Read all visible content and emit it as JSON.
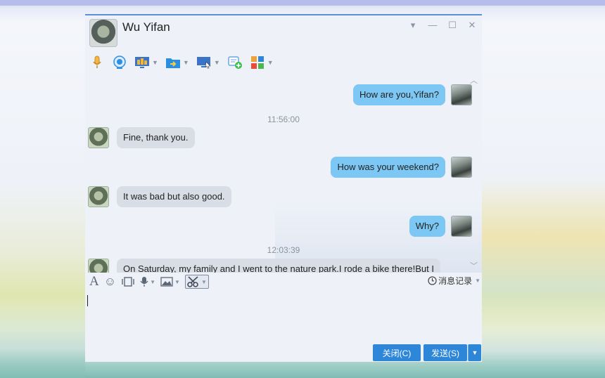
{
  "window": {
    "contact_name": "Wu Yifan",
    "controls": {
      "menu": "▾",
      "minimize": "—",
      "maximize": "☐",
      "close": "✕"
    }
  },
  "toolbar": {
    "items": [
      {
        "name": "voice-call",
        "icon": "microphone-icon",
        "dropdown": false
      },
      {
        "name": "video-call",
        "icon": "camera-icon",
        "dropdown": false
      },
      {
        "name": "remote-desktop",
        "icon": "screen-share-icon",
        "dropdown": true
      },
      {
        "name": "send-file",
        "icon": "folder-icon",
        "dropdown": true
      },
      {
        "name": "remote-assist",
        "icon": "monitor-icon",
        "dropdown": true
      },
      {
        "name": "create-discussion",
        "icon": "chat-add-icon",
        "dropdown": false
      },
      {
        "name": "apps",
        "icon": "apps-grid-icon",
        "dropdown": true
      }
    ]
  },
  "chat": {
    "messages": [
      {
        "from": "me",
        "text": "How are you,Yifan?"
      },
      {
        "type": "time",
        "text": "11:56:00"
      },
      {
        "from": "wu",
        "text": "Fine, thank you."
      },
      {
        "from": "me",
        "text": "How was your weekend?"
      },
      {
        "from": "wu",
        "text": "It was bad but also good."
      },
      {
        "from": "me",
        "text": "Why?"
      },
      {
        "type": "time",
        "text": "12:03:39"
      },
      {
        "from": "wu",
        "text": "On Saturday, my family and I went to the nature park.I rode a bike there!But I"
      }
    ]
  },
  "input_toolbar": {
    "font": "A",
    "emoji": "☺",
    "history_label": "消息记录"
  },
  "footer": {
    "close_label": "关闭(C)",
    "send_label": "发送(S)"
  },
  "colors": {
    "outgoing_bubble": "#7cc7f4",
    "incoming_bubble": "#d9dee6",
    "button_blue": "#2d86d8"
  }
}
